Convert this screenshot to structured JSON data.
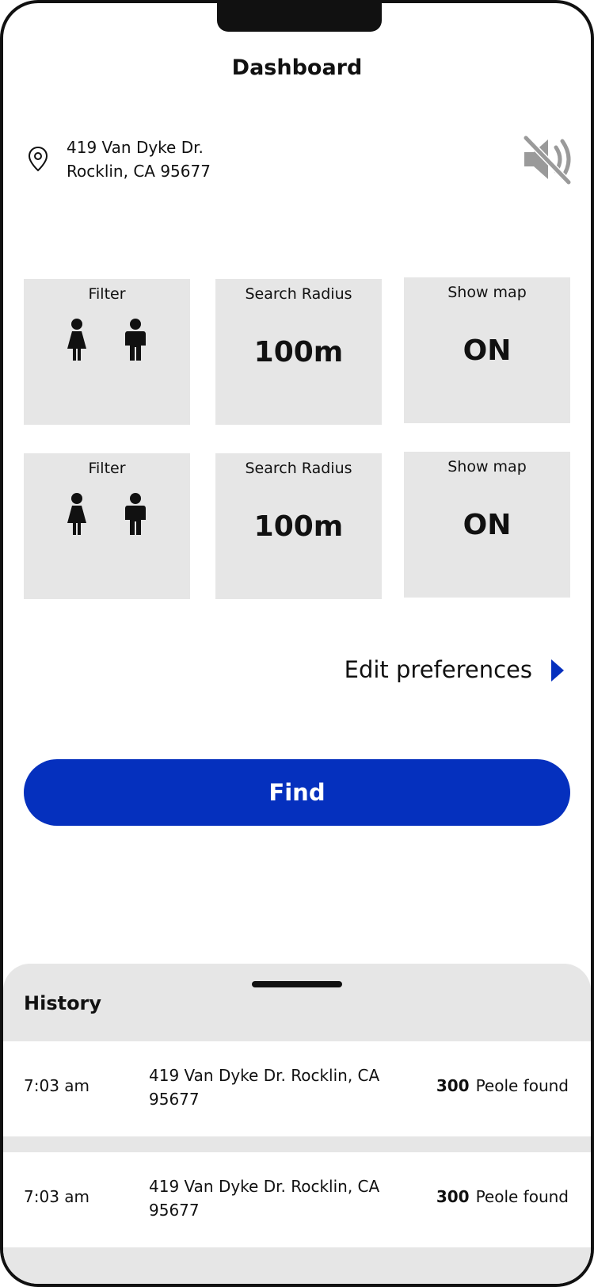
{
  "header": {
    "title": "Dashboard"
  },
  "location": {
    "line1": "419 Van Dyke Dr.",
    "line2": "Rocklin, CA 95677",
    "pin_icon": "location-pin-icon",
    "sound_icon": "speaker-muted-icon"
  },
  "cards": [
    {
      "label": "Filter",
      "icons": [
        "female-icon",
        "male-icon"
      ]
    },
    {
      "label": "Search Radius",
      "value": "100m"
    },
    {
      "label": "Show map",
      "value": "ON"
    },
    {
      "label": "Filter",
      "icons": [
        "female-icon",
        "male-icon"
      ]
    },
    {
      "label": "Search Radius",
      "value": "100m"
    },
    {
      "label": "Show map",
      "value": "ON"
    }
  ],
  "edit_preferences": {
    "label": "Edit preferences",
    "icon": "chevron-right-icon"
  },
  "find_button": {
    "label": "Find"
  },
  "history": {
    "title": "History",
    "rows": [
      {
        "time": "7:03 am",
        "address": "419 Van Dyke Dr. Rocklin, CA 95677",
        "count": "300",
        "count_label": "Peole found"
      },
      {
        "time": "7:03 am",
        "address": "419 Van Dyke Dr. Rocklin, CA 95677",
        "count": "300",
        "count_label": "Peole found"
      }
    ]
  },
  "colors": {
    "accent": "#0530be",
    "card_bg": "#e6e6e6",
    "muted_icon": "#9a9a9a"
  }
}
